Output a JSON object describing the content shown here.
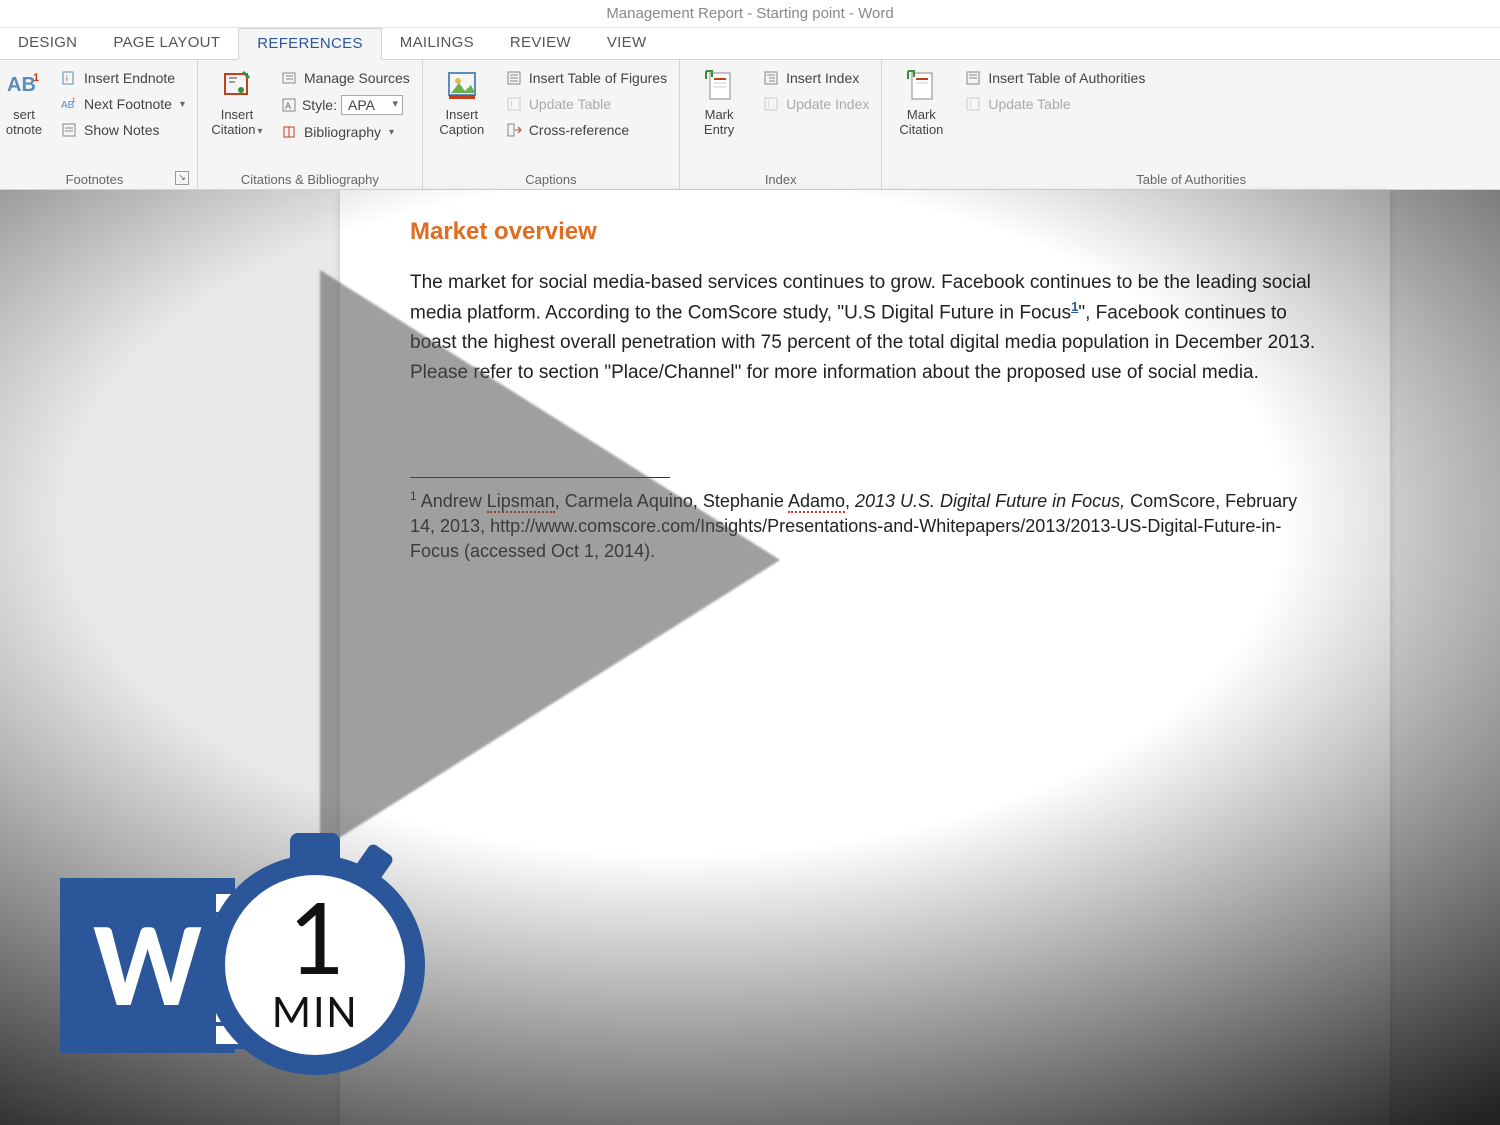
{
  "title": "Management Report - Starting point - Word",
  "tabs": {
    "design": "DESIGN",
    "page_layout": "PAGE LAYOUT",
    "references": "REFERENCES",
    "mailings": "MAILINGS",
    "review": "REVIEW",
    "view": "VIEW"
  },
  "ribbon": {
    "footnotes": {
      "insert_footnote_top": "sert",
      "insert_footnote_bottom": "otnote",
      "insert_endnote": "Insert Endnote",
      "next_footnote": "Next Footnote",
      "show_notes": "Show Notes",
      "group": "Footnotes"
    },
    "citations": {
      "insert_citation": "Insert Citation",
      "manage_sources": "Manage Sources",
      "style_label": "Style:",
      "style_value": "APA",
      "bibliography": "Bibliography",
      "group": "Citations & Bibliography"
    },
    "captions": {
      "insert_caption": "Insert Caption",
      "insert_tof": "Insert Table of Figures",
      "update_table": "Update Table",
      "cross_ref": "Cross-reference",
      "group": "Captions"
    },
    "index": {
      "mark_entry": "Mark Entry",
      "insert_index": "Insert Index",
      "update_index": "Update Index",
      "group": "Index"
    },
    "toa": {
      "mark_citation": "Mark Citation",
      "insert_toa": "Insert Table of Authorities",
      "update_table": "Update Table",
      "group": "Table of Authorities"
    }
  },
  "document": {
    "heading": "Market overview",
    "para_a": "The market for social media-based services continues to grow. Facebook continues to be the leading social media platform.  According to the ComScore study, \"U.S Digital Future in Focus",
    "para_b": "\", Facebook continues to boast the highest overall penetration with 75 percent of the total digital media population in December 2013. Please refer to section \"Place/Channel\" for more information about the proposed use of social media.",
    "footnote_ref": "1",
    "footnote_num": "1",
    "footnote_a": " Andrew ",
    "footnote_name1": "Lipsman",
    "footnote_b": ", Carmela Aquino, Stephanie ",
    "footnote_name2": "Adamo",
    "footnote_c": ", ",
    "footnote_title": "2013 U.S. Digital Future in Focus,",
    "footnote_d": " ComScore, February 14, 2013, http://www.comscore.com/Insights/Presentations-and-Whitepapers/2013/2013-US-Digital-Future-in-Focus (accessed Oct 1, 2014)."
  },
  "badge": {
    "logo": "W",
    "number": "1",
    "unit": "MIN"
  }
}
